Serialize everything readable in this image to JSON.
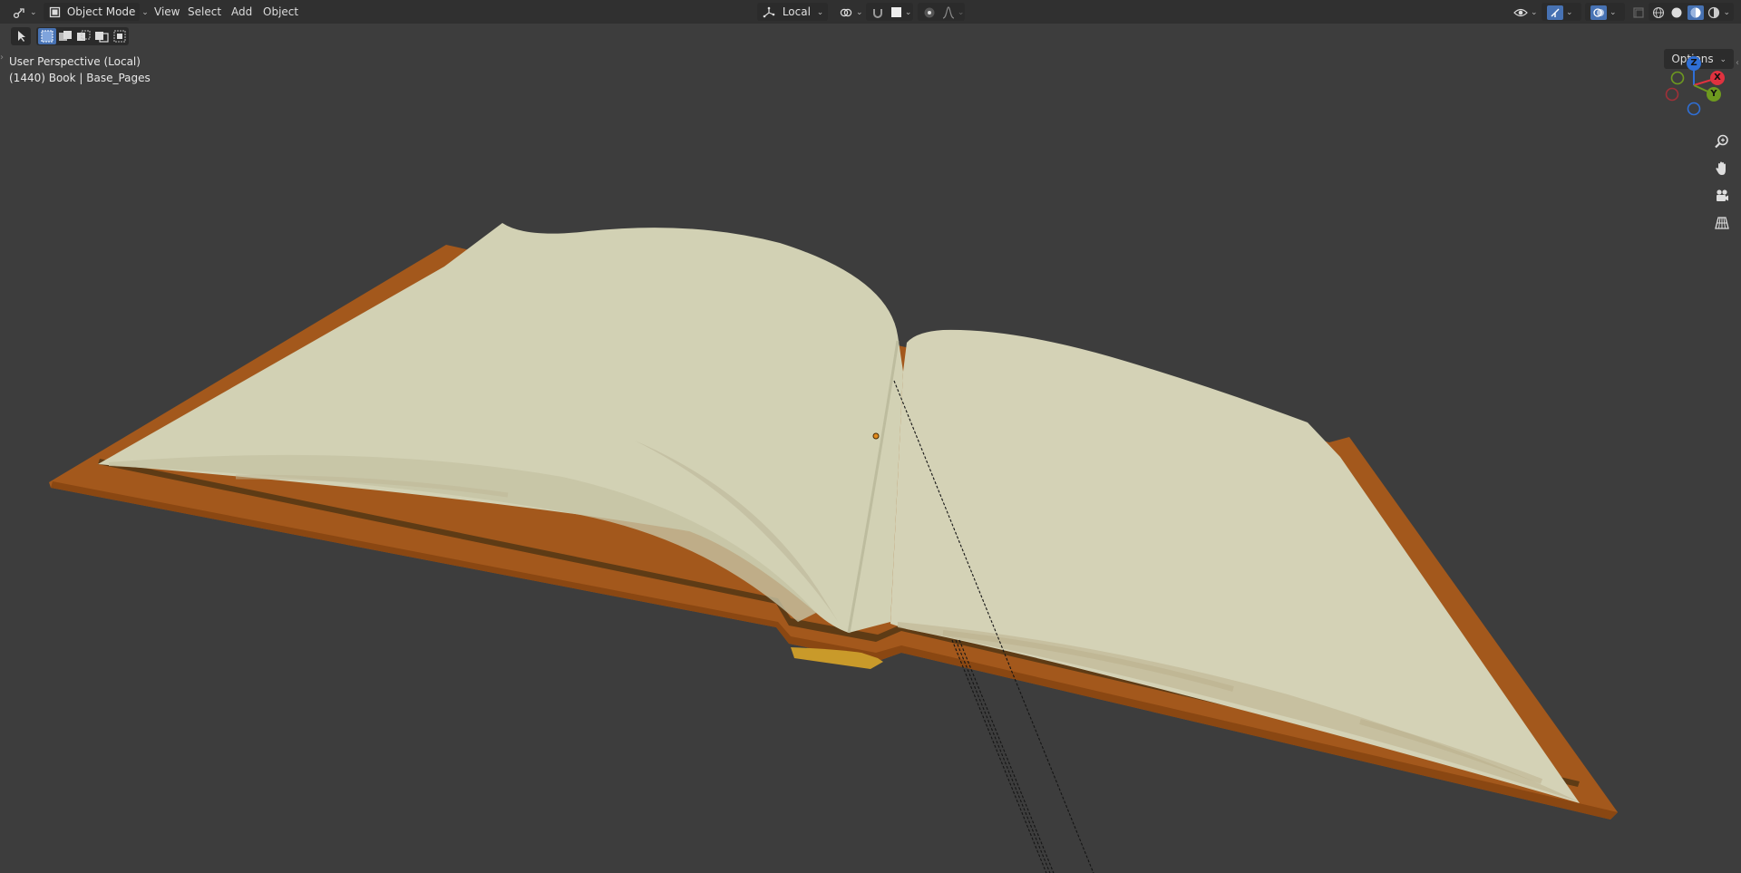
{
  "header": {
    "mode_label": "Object Mode",
    "menus": [
      "View",
      "Select",
      "Add",
      "Object"
    ],
    "transform_orientation": "Local",
    "options_label": "Options"
  },
  "viewport": {
    "perspective_label": "User Perspective (Local)",
    "object_info": "(1440) Book | Base_Pages"
  },
  "gizmo": {
    "z_label": "Z",
    "x_label": "X",
    "y_label": "Y",
    "z_color": "#2f6fd6",
    "x_color": "#e0323f",
    "y_color": "#6e9a1f"
  },
  "icons": {
    "editor_type": "editor-type-icon",
    "zoom": "zoom-icon",
    "pan": "hand-icon",
    "camera": "camera-icon",
    "ortho": "grid-icon"
  },
  "colors": {
    "accent": "#4772b3",
    "book_cover": "#a3581c",
    "page": "#d2d1b4",
    "bookmark": "#c99a2a"
  }
}
